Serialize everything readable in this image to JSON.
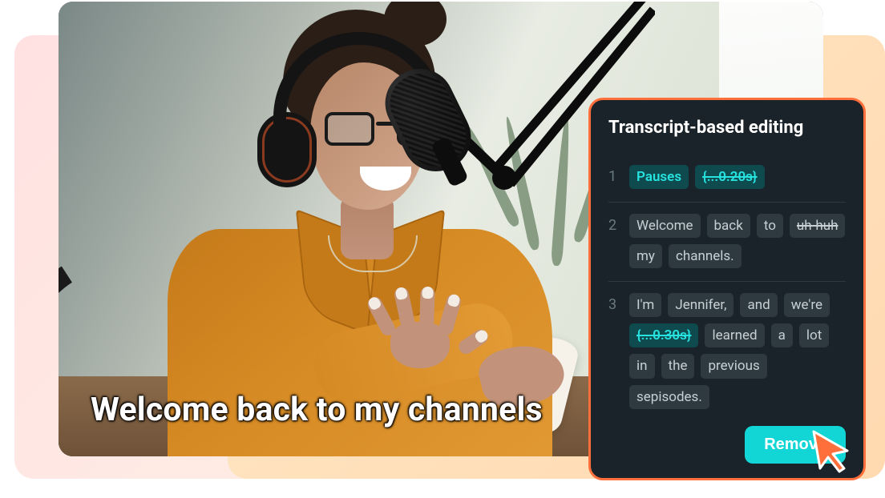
{
  "caption": "Welcome back to my channels",
  "panel": {
    "title": "Transcript-based editing",
    "remove_label": "Remove",
    "lines": [
      {
        "num": "1",
        "tokens": [
          {
            "text": "Pauses",
            "hl": true,
            "strike": false
          },
          {
            "text": "{...0.20s}",
            "hl": true,
            "strike": true
          }
        ]
      },
      {
        "num": "2",
        "tokens": [
          {
            "text": "Welcome",
            "hl": false,
            "strike": false
          },
          {
            "text": "back",
            "hl": false,
            "strike": false
          },
          {
            "text": "to",
            "hl": false,
            "strike": false
          },
          {
            "text": "uh-huh",
            "hl": false,
            "strike": true
          },
          {
            "text": "my",
            "hl": false,
            "strike": false
          },
          {
            "text": "channels.",
            "hl": false,
            "strike": false
          }
        ]
      },
      {
        "num": "3",
        "tokens": [
          {
            "text": "I'm",
            "hl": false,
            "strike": false
          },
          {
            "text": "Jennifer,",
            "hl": false,
            "strike": false
          },
          {
            "text": "and",
            "hl": false,
            "strike": false
          },
          {
            "text": "we're",
            "hl": false,
            "strike": false
          },
          {
            "text": "{...0.30s}",
            "hl": true,
            "strike": true
          },
          {
            "text": "learned",
            "hl": false,
            "strike": false
          },
          {
            "text": "a",
            "hl": false,
            "strike": false
          },
          {
            "text": "lot",
            "hl": false,
            "strike": false
          },
          {
            "text": "in",
            "hl": false,
            "strike": false
          },
          {
            "text": "the",
            "hl": false,
            "strike": false
          },
          {
            "text": "previous",
            "hl": false,
            "strike": false
          },
          {
            "text": "sepisodes.",
            "hl": false,
            "strike": false
          }
        ]
      }
    ]
  }
}
